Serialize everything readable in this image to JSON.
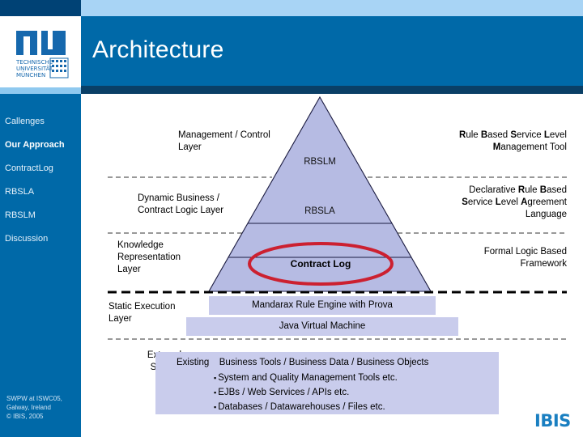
{
  "header": {
    "title": "Architecture",
    "logo_alt": "tum-logo",
    "logo_text_lines": [
      "TECHNISCHE",
      "UNIVERSITÄT",
      "MÜNCHEN"
    ]
  },
  "sidebar": {
    "items": [
      {
        "label": "Callenges",
        "active": false
      },
      {
        "label": "Our Approach",
        "active": true
      },
      {
        "label": "ContractLog",
        "active": false
      },
      {
        "label": "RBSLA",
        "active": false
      },
      {
        "label": "RBSLM",
        "active": false
      },
      {
        "label": "Discussion",
        "active": false
      }
    ],
    "footer": "SWPW at ISWC05,\nGalway, Ireland\n© IBIS, 2005"
  },
  "brand": {
    "ibis": "IBIS"
  },
  "diagram": {
    "layers": [
      {
        "left_label": "Management / Control\nLayer",
        "center_label": "RBSLM",
        "right_label_html": "<b>R</b>ule <b>B</b>ased <b>S</b>ervice <b>L</b>evel<br><b>M</b>anagement Tool"
      },
      {
        "left_label": "Dynamic Business /\nContract Logic Layer",
        "center_label": "RBSLA",
        "right_label_html": "Declarative <b>R</b>ule <b>B</b>ased<br><b>S</b>ervice <b>L</b>evel <b>A</b>greement<br>Language"
      },
      {
        "left_label": "Knowledge\nRepresentation\nLayer",
        "center_label": "Contract Log",
        "right_label_html": "Formal Logic Based<br>Framework"
      },
      {
        "left_label": "Static Execution\nLayer",
        "boxes": [
          "Mandarax Rule Engine with Prova",
          "Java Virtual Machine"
        ]
      },
      {
        "left_label": "External\nSystem\nLayer",
        "ext_existing": "Existing",
        "ext_heading": "Business Tools / Business Data / Business Objects",
        "ext_items": [
          "System and Quality Management Tools etc.",
          "EJBs / Web Services / APIs etc.",
          "Databases / Datawarehouses / Files etc."
        ]
      }
    ]
  },
  "colors": {
    "header_blue": "#0069a8",
    "header_light": "#a8d4f5",
    "header_navy": "#0a3f66",
    "pyramid_fill": "#b6bbe3",
    "box_fill": "#c9ccec",
    "ellipse_red": "#cc2030",
    "ibis_blue": "#1a7fc1"
  }
}
